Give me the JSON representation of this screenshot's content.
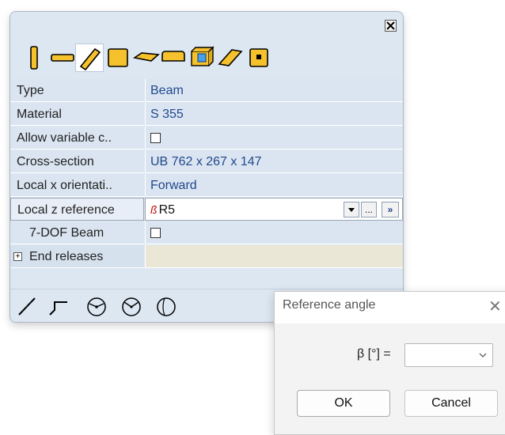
{
  "properties": [
    {
      "label": "Type",
      "value": "Beam"
    },
    {
      "label": "Material",
      "value": "S 355"
    },
    {
      "label": "Allow variable c..",
      "value": ""
    },
    {
      "label": "Cross-section",
      "value": "UB 762 x 267 x 147"
    },
    {
      "label": "Local x orientati..",
      "value": "Forward"
    },
    {
      "label": "Local z reference",
      "value": "R5"
    },
    {
      "label": "7-DOF Beam",
      "value": ""
    },
    {
      "label": "End releases",
      "value": ""
    }
  ],
  "dropdown": {
    "ellipsis": "...",
    "go": "»"
  },
  "dialog": {
    "title": "Reference angle",
    "angle_label": "β [°] =",
    "angle_value": "",
    "ok": "OK",
    "cancel": "Cancel"
  },
  "icons": {
    "toolbar": [
      "column-member-icon",
      "beam-member-icon",
      "brace-member-icon",
      "plate-member-icon",
      "slab-member-icon",
      "wall-member-icon",
      "element-box-icon",
      "diagonal-plate-icon",
      "panel-icon"
    ],
    "bottom": [
      "straight-line-icon",
      "polyline-icon",
      "arc-three-points-icon",
      "arc-center-icon",
      "circle-icon"
    ]
  },
  "colors": {
    "panel_bg": "#dde7f2",
    "value_text": "#22488c",
    "reference_mark": "#c00000"
  }
}
